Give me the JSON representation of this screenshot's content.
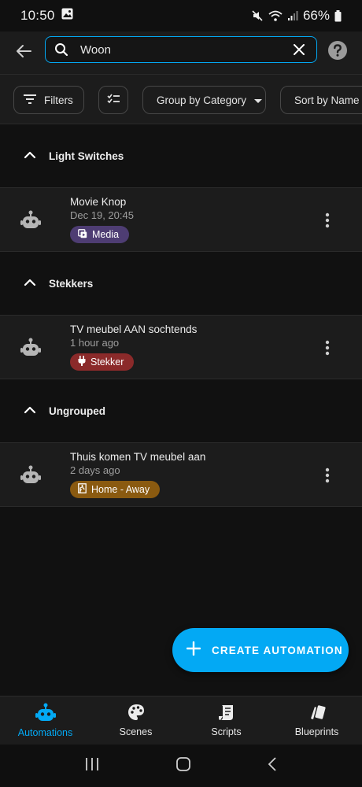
{
  "status_bar": {
    "time": "10:50",
    "battery": "66%",
    "icons": [
      "gallery-icon",
      "mute-icon",
      "wifi-icon",
      "signal-icon",
      "battery-icon"
    ]
  },
  "top_bar": {
    "search_value": "Woon",
    "icons": [
      "back-arrow-icon",
      "search-icon",
      "clear-icon",
      "help-icon"
    ]
  },
  "chips": {
    "filters": "Filters",
    "group_by": "Group by Category",
    "sort_by": "Sort by Name"
  },
  "groups": [
    {
      "title": "Light Switches",
      "items": [
        {
          "name": "Movie Knop",
          "time": "Dec 19, 20:45",
          "badge": "Media",
          "badge_color": "#4e3d73",
          "badge_icon": "media-icon"
        }
      ]
    },
    {
      "title": "Stekkers",
      "items": [
        {
          "name": "TV meubel AAN sochtends",
          "time": "1 hour ago",
          "badge": "Stekker",
          "badge_color": "#8b2a2a",
          "badge_icon": "plug-icon"
        }
      ]
    },
    {
      "title": "Ungrouped",
      "items": [
        {
          "name": "Thuis komen TV meubel aan",
          "time": "2 days ago",
          "badge": "Home - Away",
          "badge_color": "#8a5a10",
          "badge_icon": "door-icon"
        }
      ]
    }
  ],
  "fab": {
    "label": "CREATE AUTOMATION"
  },
  "bottom_nav": [
    {
      "label": "Automations",
      "icon": "robot-icon",
      "active": true
    },
    {
      "label": "Scenes",
      "icon": "palette-icon",
      "active": false
    },
    {
      "label": "Scripts",
      "icon": "script-icon",
      "active": false
    },
    {
      "label": "Blueprints",
      "icon": "blueprint-icon",
      "active": false
    }
  ],
  "colors": {
    "accent": "#03a9f4",
    "background": "#111111",
    "surface": "#1c1c1c"
  }
}
